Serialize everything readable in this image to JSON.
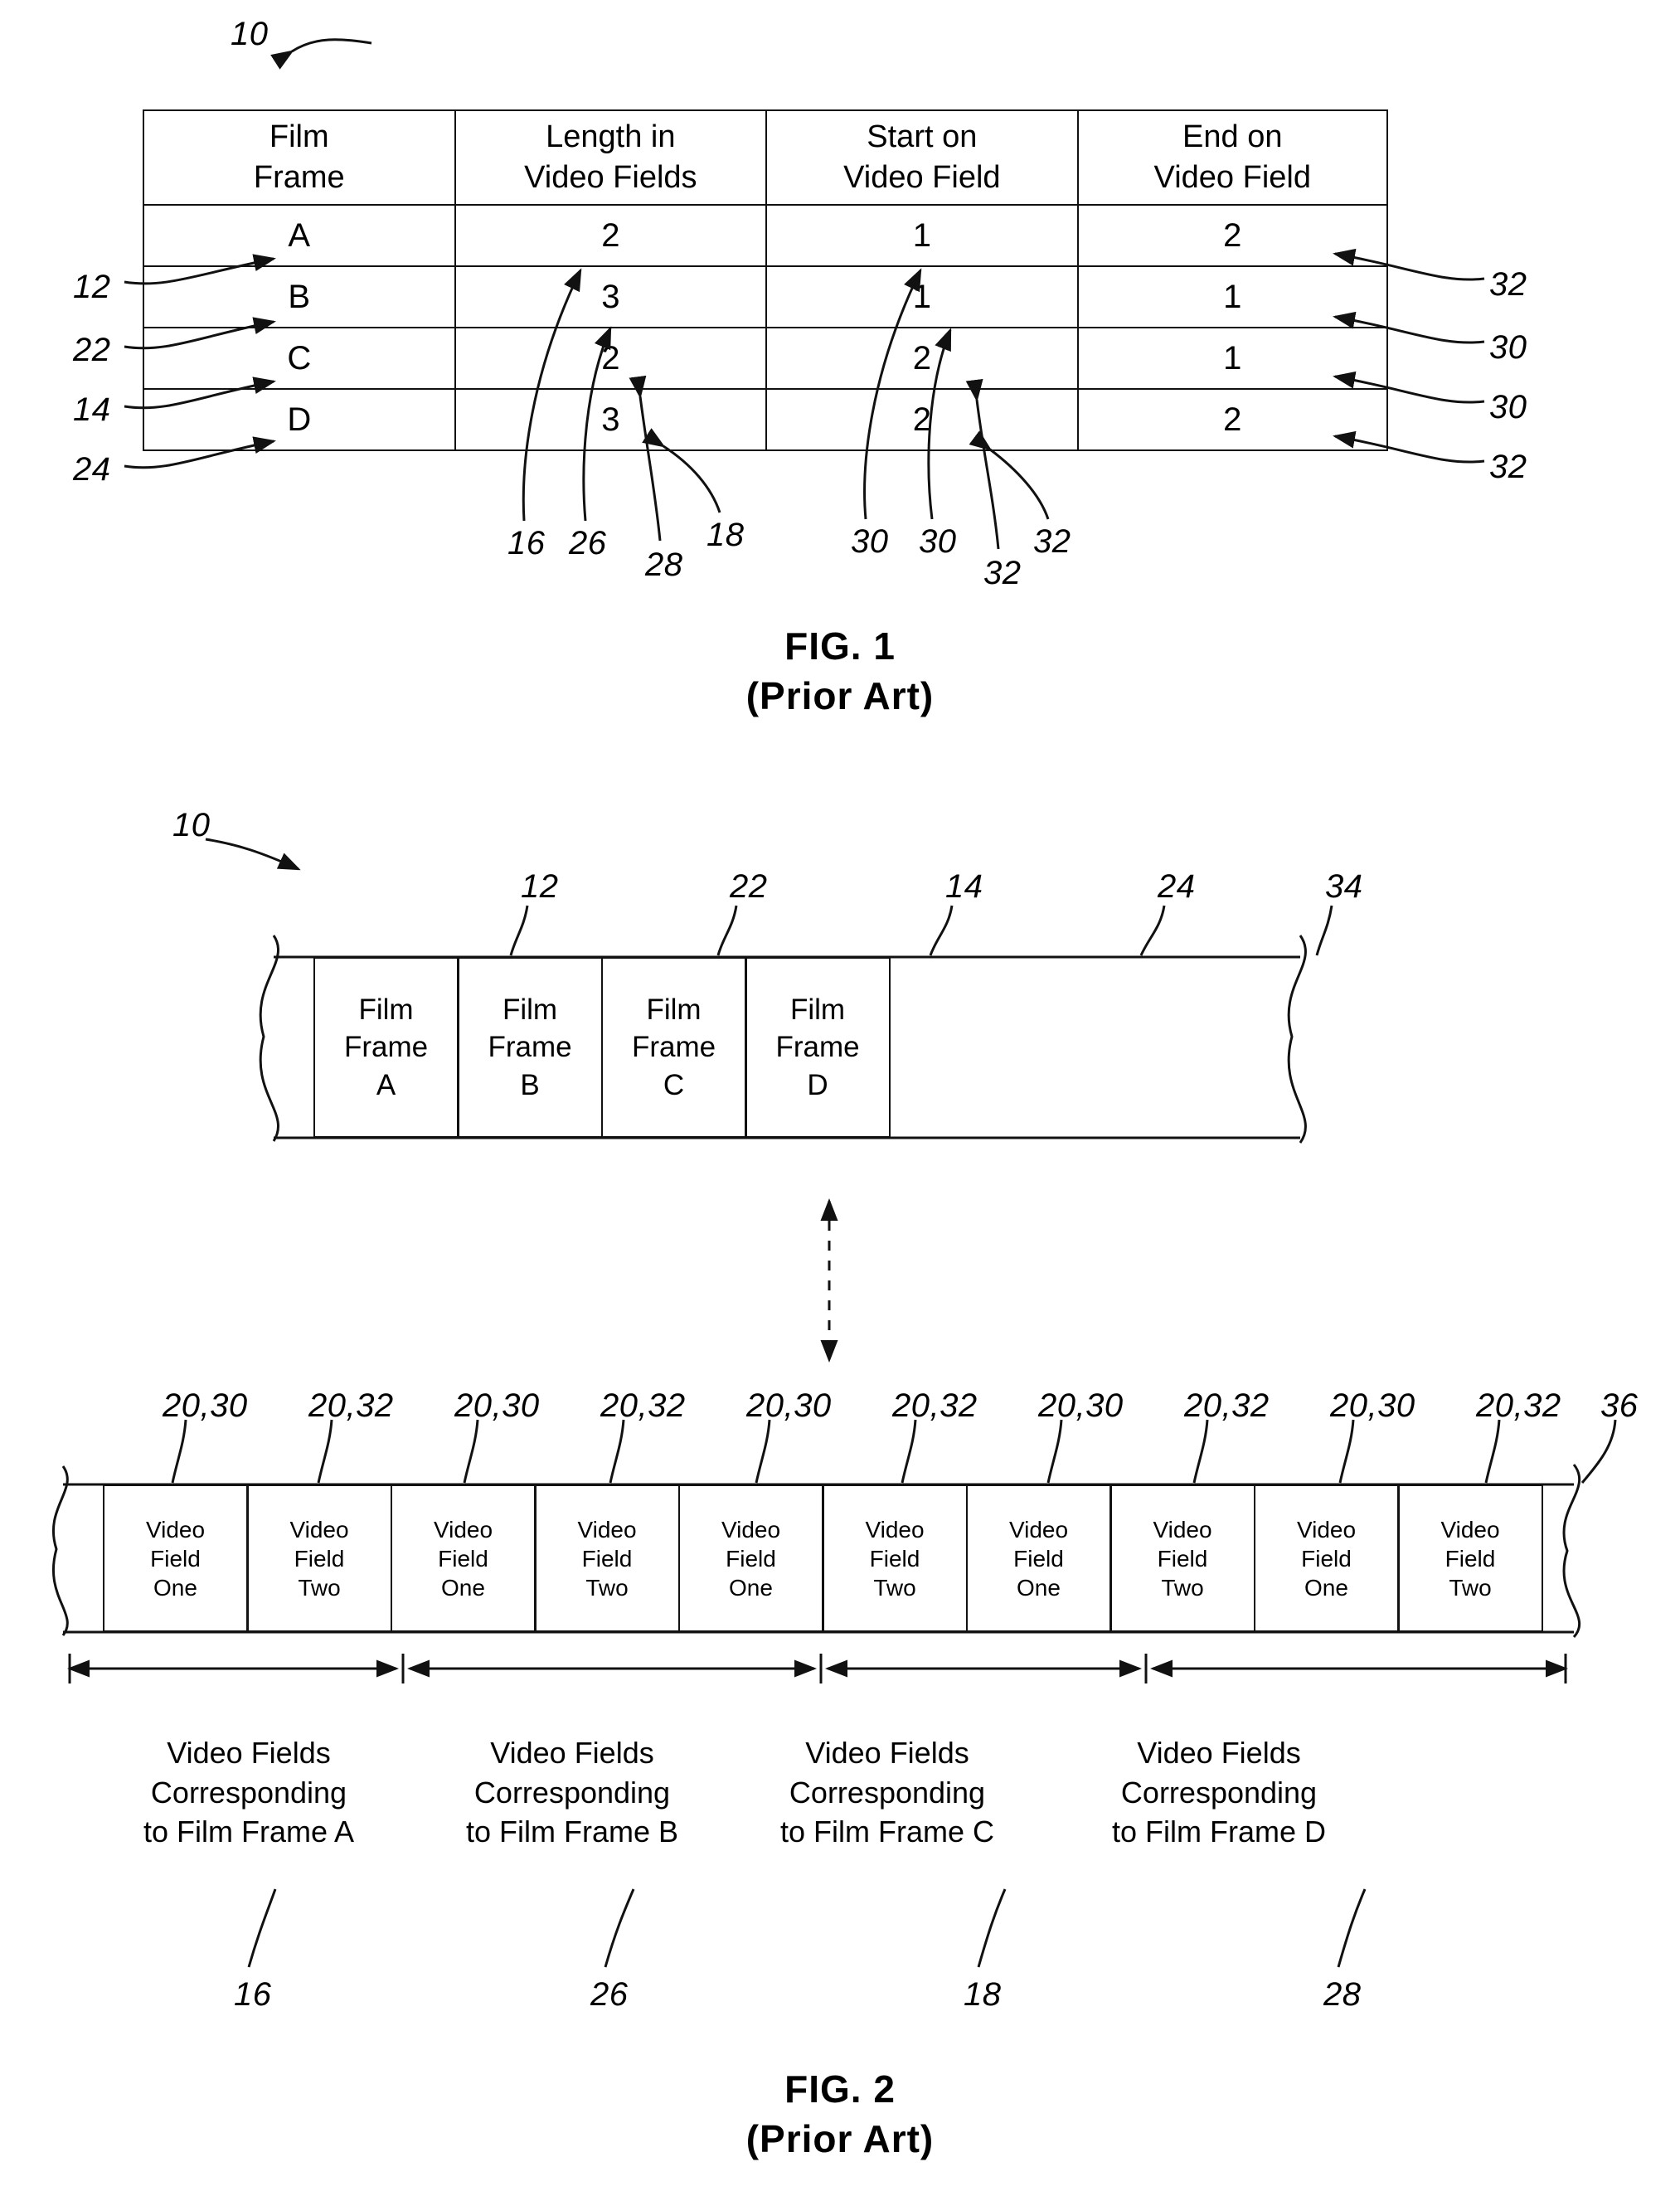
{
  "figure1": {
    "assembly_ref": "10",
    "caption_line1": "FIG. 1",
    "caption_line2": "(Prior Art)",
    "table": {
      "headers": [
        "Film\nFrame",
        "Length in\nVideo Fields",
        "Start on\nVideo Field",
        "End on\nVideo Field"
      ],
      "rows": [
        {
          "frame": "A",
          "length": "2",
          "start": "1",
          "end": "2"
        },
        {
          "frame": "B",
          "length": "3",
          "start": "1",
          "end": "1"
        },
        {
          "frame": "C",
          "length": "2",
          "start": "2",
          "end": "1"
        },
        {
          "frame": "D",
          "length": "3",
          "start": "2",
          "end": "2"
        }
      ]
    },
    "left_refs": [
      "12",
      "22",
      "14",
      "24"
    ],
    "right_refs": [
      "32",
      "30",
      "30",
      "32"
    ],
    "bottom_refs_left": [
      "16",
      "26",
      "28",
      "18"
    ],
    "bottom_refs_right": [
      "30",
      "30",
      "32",
      "32"
    ]
  },
  "figure2": {
    "assembly_ref": "10",
    "caption_line1": "FIG. 2",
    "caption_line2": "(Prior Art)",
    "film_frames": [
      {
        "label": "Film\nFrame\nA",
        "ref": "12"
      },
      {
        "label": "Film\nFrame\nB",
        "ref": "22"
      },
      {
        "label": "Film\nFrame\nC",
        "ref": "14"
      },
      {
        "label": "Film\nFrame\nD",
        "ref": "24"
      }
    ],
    "film_strip_end_ref": "34",
    "video_fields": [
      {
        "label": "Video\nField\nOne",
        "ref": "20,30"
      },
      {
        "label": "Video\nField\nTwo",
        "ref": "20,32"
      },
      {
        "label": "Video\nField\nOne",
        "ref": "20,30"
      },
      {
        "label": "Video\nField\nTwo",
        "ref": "20,32"
      },
      {
        "label": "Video\nField\nOne",
        "ref": "20,30"
      },
      {
        "label": "Video\nField\nTwo",
        "ref": "20,32"
      },
      {
        "label": "Video\nField\nOne",
        "ref": "20,30"
      },
      {
        "label": "Video\nField\nTwo",
        "ref": "20,32"
      },
      {
        "label": "Video\nField\nOne",
        "ref": "20,30"
      },
      {
        "label": "Video\nField\nTwo",
        "ref": "20,32"
      }
    ],
    "video_strip_end_ref": "36",
    "groups": [
      {
        "text": "Video Fields\nCorresponding\nto Film Frame A",
        "ref": "16"
      },
      {
        "text": "Video Fields\nCorresponding\nto Film Frame B",
        "ref": "26"
      },
      {
        "text": "Video Fields\nCorresponding\nto Film Frame C",
        "ref": "18"
      },
      {
        "text": "Video Fields\nCorresponding\nto Film Frame D",
        "ref": "28"
      }
    ]
  }
}
